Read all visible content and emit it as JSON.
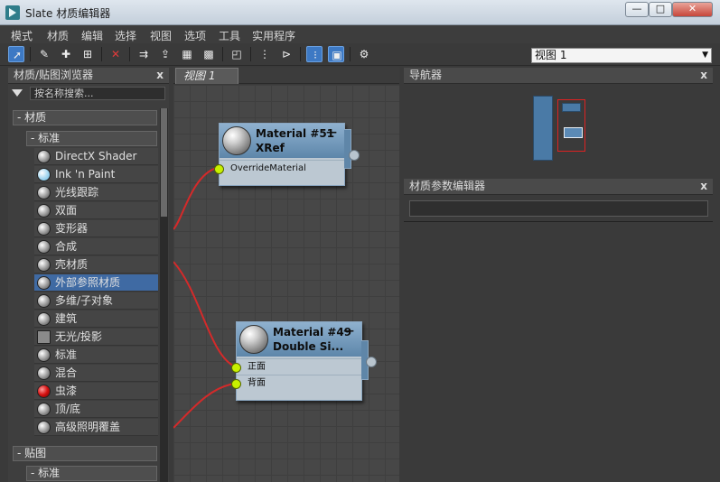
{
  "window": {
    "title": "Slate 材质编辑器",
    "min": "—",
    "max": "□",
    "close": "✕"
  },
  "menu": [
    "模式",
    "材质",
    "编辑",
    "选择",
    "视图",
    "选项",
    "工具",
    "实用程序"
  ],
  "toolbar": {
    "view_select": "视图 1"
  },
  "browser": {
    "title": "材质/贴图浏览器",
    "close": "x",
    "search_placeholder": "按名称搜索...",
    "group_materials": "- 材质",
    "sub_standard": "- 标准",
    "items": [
      {
        "label": "DirectX Shader",
        "swatch": "ball"
      },
      {
        "label": "Ink 'n Paint",
        "swatch": "light"
      },
      {
        "label": "光线跟踪",
        "swatch": "ball"
      },
      {
        "label": "双面",
        "swatch": "ball"
      },
      {
        "label": "变形器",
        "swatch": "ball"
      },
      {
        "label": "合成",
        "swatch": "ball"
      },
      {
        "label": "壳材质",
        "swatch": "ball"
      },
      {
        "label": "外部参照材质",
        "swatch": "ball"
      },
      {
        "label": "多维/子对象",
        "swatch": "ball"
      },
      {
        "label": "建筑",
        "swatch": "ball"
      },
      {
        "label": "无光/投影",
        "swatch": "flat"
      },
      {
        "label": "标准",
        "swatch": "ball"
      },
      {
        "label": "混合",
        "swatch": "ball"
      },
      {
        "label": "虫漆",
        "swatch": "red"
      },
      {
        "label": "顶/底",
        "swatch": "ball"
      },
      {
        "label": "高级照明覆盖",
        "swatch": "ball"
      }
    ],
    "group_maps": "- 贴图",
    "sub_standard_maps": "- 标准"
  },
  "view": {
    "tab": "视图 1",
    "node1": {
      "name": "Material #51",
      "type": "XRef",
      "collapse": "—",
      "slot": "OverrideMaterial"
    },
    "node2": {
      "name": "Material #49",
      "type": "Double  Si...",
      "collapse": "—",
      "slot1": "正面",
      "slot2": "背面"
    }
  },
  "navigator": {
    "title": "导航器",
    "close": "x"
  },
  "params": {
    "title": "材质参数编辑器",
    "close": "x"
  },
  "colors": {
    "accent": "#3d79c4",
    "selected": "#3f6aa3",
    "wire": "#d42a2a",
    "port": "#c8f000"
  }
}
